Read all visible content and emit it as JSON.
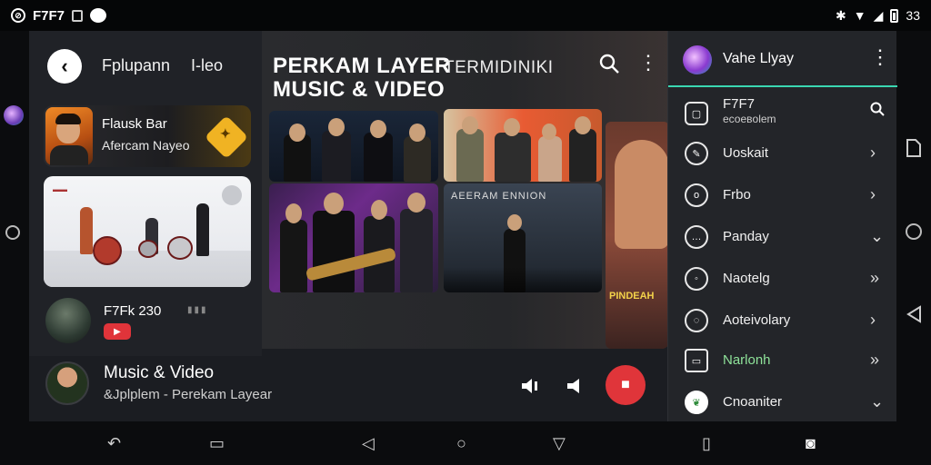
{
  "status_bar": {
    "app_code": "F7F7",
    "time": "33"
  },
  "left": {
    "header_title": "Fplupann",
    "header_title2": "I-leo",
    "card1": {
      "line1": "Flausk Bar",
      "line2": "Afercam Nayeo"
    },
    "row3": {
      "title": "F7Fk 230"
    }
  },
  "center": {
    "title_line1": "PERKAM LAYER",
    "title_line2": "MUSIC & VIDEO",
    "title_right": "TERMIDINIKI",
    "tile4_text": "AEERAM ENNION",
    "tile5_text": "PINDEAH"
  },
  "now_playing": {
    "title": "Music & Video",
    "subtitle": "&Jplplem  - Perekam Layear"
  },
  "menu": {
    "user_name": "Vahe Llyay",
    "items": [
      {
        "label": "F7F7",
        "sub": "eсоевolem",
        "icon": "square-icon",
        "chevron": "🔍"
      },
      {
        "label": "Uoskait",
        "sub": "",
        "icon": "pencil-icon",
        "chevron": "›"
      },
      {
        "label": "Frbo",
        "sub": "",
        "icon": "o-icon",
        "chevron": "›"
      },
      {
        "label": "Panday",
        "sub": "",
        "icon": "chat-icon",
        "chevron": "⌄"
      },
      {
        "label": "Naotelg",
        "sub": "",
        "icon": "circle-icon",
        "chevron": "»"
      },
      {
        "label": "Aoteivolary",
        "sub": "",
        "icon": "bubble-icon",
        "chevron": "›"
      },
      {
        "label": "Narlonh",
        "sub": "",
        "icon": "message-icon",
        "chevron": "»"
      },
      {
        "label": "Cnoaniter",
        "sub": "",
        "icon": "leaf-icon",
        "chevron": "⌄"
      }
    ]
  },
  "colors": {
    "accent": "#3ad7b1",
    "stop_red": "#e0353a"
  }
}
